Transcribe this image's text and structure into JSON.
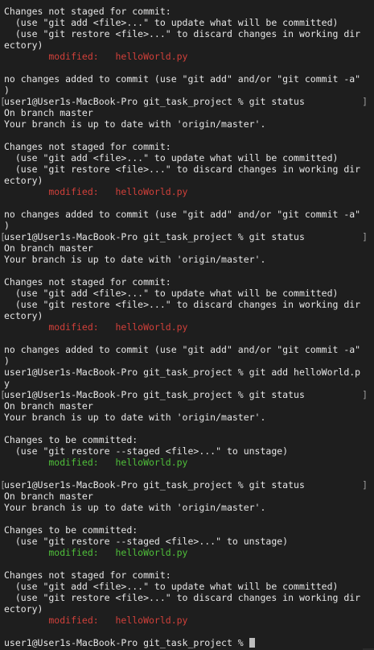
{
  "terminal": {
    "lines": [
      {
        "text": "Changes not staged for commit:"
      },
      {
        "text": "  (use \"git add <file>...\" to update what will be committed)"
      },
      {
        "text": "  (use \"git restore <file>...\" to discard changes in working dir"
      },
      {
        "text": "ectory)"
      },
      {
        "text": "        modified:   helloWorld.py",
        "color": "red"
      },
      {
        "text": ""
      },
      {
        "text": "no changes added to commit (use \"git add\" and/or \"git commit -a\""
      },
      {
        "text": ")"
      },
      {
        "text": "user1@User1s-MacBook-Pro git_task_project % git status",
        "bracketLeft": "[",
        "bracketRight": "]"
      },
      {
        "text": "On branch master"
      },
      {
        "text": "Your branch is up to date with 'origin/master'."
      },
      {
        "text": ""
      },
      {
        "text": "Changes not staged for commit:"
      },
      {
        "text": "  (use \"git add <file>...\" to update what will be committed)"
      },
      {
        "text": "  (use \"git restore <file>...\" to discard changes in working dir"
      },
      {
        "text": "ectory)"
      },
      {
        "text": "        modified:   helloWorld.py",
        "color": "red"
      },
      {
        "text": ""
      },
      {
        "text": "no changes added to commit (use \"git add\" and/or \"git commit -a\""
      },
      {
        "text": ")"
      },
      {
        "text": "user1@User1s-MacBook-Pro git_task_project % git status",
        "bracketLeft": "[",
        "bracketRight": "]"
      },
      {
        "text": "On branch master"
      },
      {
        "text": "Your branch is up to date with 'origin/master'."
      },
      {
        "text": ""
      },
      {
        "text": "Changes not staged for commit:"
      },
      {
        "text": "  (use \"git add <file>...\" to update what will be committed)"
      },
      {
        "text": "  (use \"git restore <file>...\" to discard changes in working dir"
      },
      {
        "text": "ectory)"
      },
      {
        "text": "        modified:   helloWorld.py",
        "color": "red"
      },
      {
        "text": ""
      },
      {
        "text": "no changes added to commit (use \"git add\" and/or \"git commit -a\""
      },
      {
        "text": ")"
      },
      {
        "text": "user1@User1s-MacBook-Pro git_task_project % git add helloWorld.p"
      },
      {
        "text": "y"
      },
      {
        "text": "user1@User1s-MacBook-Pro git_task_project % git status",
        "bracketLeft": "[",
        "bracketRight": "]"
      },
      {
        "text": "On branch master"
      },
      {
        "text": "Your branch is up to date with 'origin/master'."
      },
      {
        "text": ""
      },
      {
        "text": "Changes to be committed:"
      },
      {
        "text": "  (use \"git restore --staged <file>...\" to unstage)"
      },
      {
        "text": "        modified:   helloWorld.py",
        "color": "green"
      },
      {
        "text": ""
      },
      {
        "text": "user1@User1s-MacBook-Pro git_task_project % git status",
        "bracketLeft": "[",
        "bracketRight": "]"
      },
      {
        "text": "On branch master"
      },
      {
        "text": "Your branch is up to date with 'origin/master'."
      },
      {
        "text": ""
      },
      {
        "text": "Changes to be committed:"
      },
      {
        "text": "  (use \"git restore --staged <file>...\" to unstage)"
      },
      {
        "text": "        modified:   helloWorld.py",
        "color": "green"
      },
      {
        "text": ""
      },
      {
        "text": "Changes not staged for commit:"
      },
      {
        "text": "  (use \"git add <file>...\" to update what will be committed)"
      },
      {
        "text": "  (use \"git restore <file>...\" to discard changes in working dir"
      },
      {
        "text": "ectory)"
      },
      {
        "text": "        modified:   helloWorld.py",
        "color": "red"
      },
      {
        "text": ""
      },
      {
        "text": "user1@User1s-MacBook-Pro git_task_project % ",
        "cursor": true
      }
    ]
  }
}
